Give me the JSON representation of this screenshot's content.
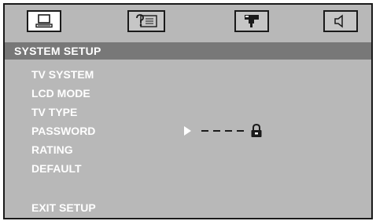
{
  "osd": {
    "tabs": [
      {
        "icon": "computer-icon",
        "active": true
      },
      {
        "icon": "help-icon",
        "active": false
      },
      {
        "icon": "camera-icon",
        "active": false
      },
      {
        "icon": "speaker-icon",
        "active": false
      }
    ],
    "section_title": "SYSTEM SETUP",
    "menu": {
      "items": [
        {
          "label": "TV SYSTEM"
        },
        {
          "label": "LCD MODE"
        },
        {
          "label": "TV TYPE"
        },
        {
          "label": "PASSWORD"
        },
        {
          "label": "RATING"
        },
        {
          "label": "DEFAULT"
        },
        {
          "label": "EXIT SETUP"
        }
      ]
    },
    "password": {
      "cursor_icon": "right-triangle-icon",
      "lock_icon": "lock-icon",
      "locked": true
    }
  },
  "colors": {
    "panel": "#b8b8b8",
    "header_bar": "#787878",
    "text": "#ffffff",
    "border": "#1a1a1a"
  }
}
